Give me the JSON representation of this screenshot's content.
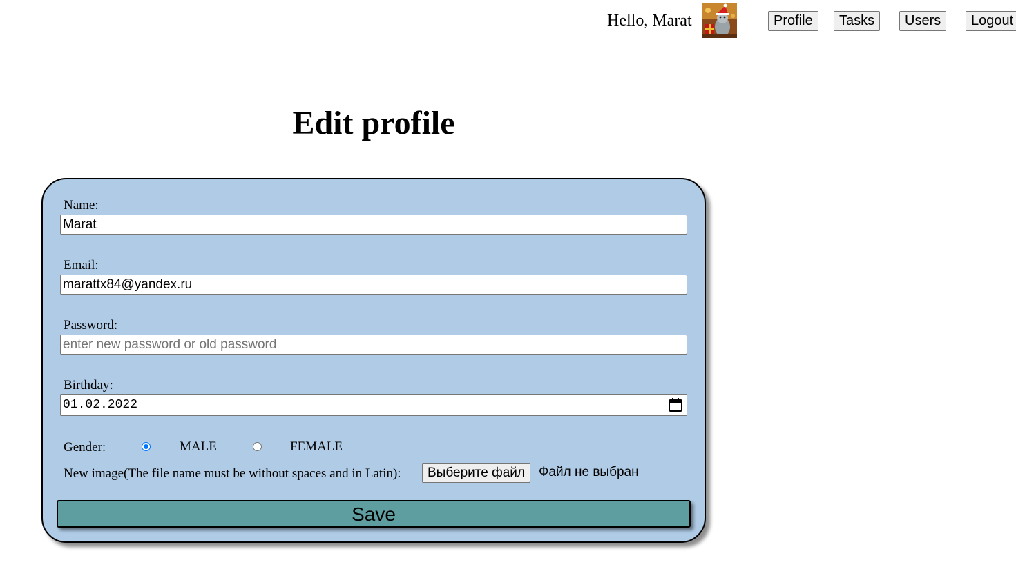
{
  "header": {
    "greeting": "Hello, Marat",
    "avatar_icon": "user-avatar-icon",
    "nav": {
      "profile": "Profile",
      "tasks": "Tasks",
      "users": "Users",
      "logout": "Logout"
    }
  },
  "page": {
    "title": "Edit profile"
  },
  "form": {
    "background_color": "#afcbe5",
    "name": {
      "label": "Name:",
      "value": "Marat"
    },
    "email": {
      "label": "Email:",
      "value": "marattx84@yandex.ru"
    },
    "password": {
      "label": "Password:",
      "value": "",
      "placeholder": "enter new password or old password"
    },
    "birthday": {
      "label": "Birthday:",
      "value": "01.02.2022",
      "icon": "calendar-icon"
    },
    "gender": {
      "label": "Gender:",
      "options": [
        {
          "label": "MALE",
          "checked": true
        },
        {
          "label": "FEMALE",
          "checked": false
        }
      ]
    },
    "image": {
      "label": "New image(The file name must be without spaces and in Latin):",
      "button": "Выберите файл",
      "status": "Файл не выбран"
    },
    "save": {
      "label": "Save",
      "color": "#5f9ea0"
    }
  }
}
